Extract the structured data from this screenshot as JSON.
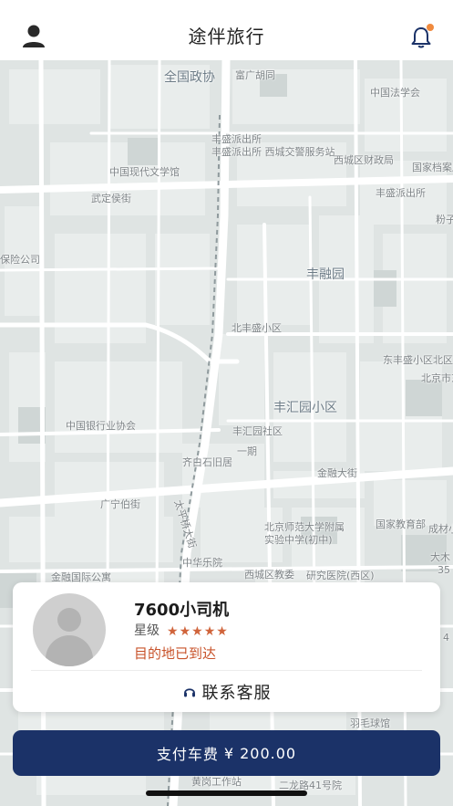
{
  "header": {
    "title": "途伴旅行",
    "profile_icon": "person-icon",
    "notification_icon": "bell-icon",
    "notification_badge_color": "#f08a3e"
  },
  "map": {
    "labels": [
      {
        "id": "quanguo",
        "text": "全国政协"
      },
      {
        "id": "caiwu",
        "text": "富广胡同"
      },
      {
        "id": "fazhan",
        "text": "中国法学会"
      },
      {
        "id": "pai1",
        "text": "丰盛派出所"
      },
      {
        "id": "jiaozhen",
        "text": "丰盛派出所\n西城交警服务站"
      },
      {
        "id": "caizheng",
        "text": "西城区财政局"
      },
      {
        "id": "dangan",
        "text": "国家档案局"
      },
      {
        "id": "wenxue",
        "text": "中国现代文学馆"
      },
      {
        "id": "wuding",
        "text": "武定侯街"
      },
      {
        "id": "pai2",
        "text": "丰盛派出所"
      },
      {
        "id": "lingzi",
        "text": "粉子"
      },
      {
        "id": "baohe",
        "text": "保险公司"
      },
      {
        "id": "fengrongyuan",
        "text": "丰融园"
      },
      {
        "id": "beifeng",
        "text": "北丰盛小区"
      },
      {
        "id": "donghuai",
        "text": "东丰盛小区北区"
      },
      {
        "id": "beijingdong",
        "text": "北京市东"
      },
      {
        "id": "fenghui",
        "text": "丰汇园小区"
      },
      {
        "id": "yinhang",
        "text": "中国银行业协会"
      },
      {
        "id": "fenghuiyuan",
        "text": "丰汇园社区"
      },
      {
        "id": "yiqi",
        "text": "一期"
      },
      {
        "id": "qibai",
        "text": "齐白石旧居"
      },
      {
        "id": "jinrong",
        "text": "金融大街"
      },
      {
        "id": "guangning",
        "text": "广宁伯街"
      },
      {
        "id": "dajie",
        "text": "太平桥大街"
      },
      {
        "id": "jiaoyu",
        "text": "国家教育部"
      },
      {
        "id": "beishi",
        "text": "北京师范大学附属\n实验中学(初中)"
      },
      {
        "id": "chengcai",
        "text": "成材小学"
      },
      {
        "id": "zhonghua",
        "text": "中华乐院"
      },
      {
        "id": "xicheng",
        "text": "西城区教委"
      },
      {
        "id": "yanjiu",
        "text": "研究医院(西区)"
      },
      {
        "id": "jinyu",
        "text": "金融国际公寓"
      },
      {
        "id": "yumao",
        "text": "羽毛球馆"
      },
      {
        "id": "jiuyuan",
        "text": "黄岗工作站"
      },
      {
        "id": "erlong",
        "text": "二龙路41号院"
      },
      {
        "id": "dada",
        "text": "大木"
      },
      {
        "id": "num35",
        "text": "35"
      },
      {
        "id": "num4",
        "text": "4"
      }
    ]
  },
  "driver": {
    "name": "7600小司机",
    "rating_label": "星级",
    "rating": 5,
    "rating_max": 5,
    "star_glyph": "★",
    "star_color": "#d0643b",
    "status": "目的地已到达",
    "status_color": "#c8532b",
    "avatar_icon": "default-avatar-icon"
  },
  "support": {
    "label": "联系客服",
    "icon": "headset-icon"
  },
  "payment": {
    "label": "支付车费",
    "currency": "¥",
    "amount": "200.00",
    "button_color": "#1b3268"
  }
}
